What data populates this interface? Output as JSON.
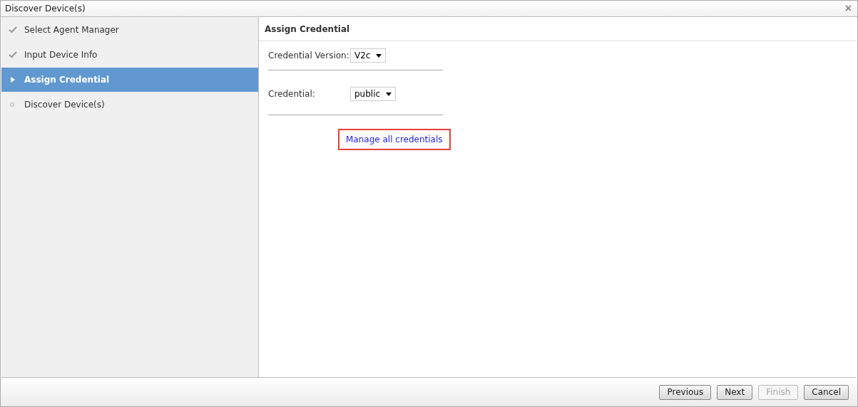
{
  "window": {
    "title": "Discover Device(s)",
    "close": "×"
  },
  "steps": [
    {
      "label": "Select Agent Manager",
      "kind": "done",
      "selected": false
    },
    {
      "label": "Input Device Info",
      "kind": "done",
      "selected": false
    },
    {
      "label": "Assign Credential",
      "kind": "current",
      "selected": true
    },
    {
      "label": "Discover Device(s)",
      "kind": "pending",
      "selected": false
    }
  ],
  "panel": {
    "title": "Assign Credential",
    "fields": [
      {
        "label": "Credential Version:",
        "value": "V2c"
      },
      {
        "label": "Credential:",
        "value": "public"
      }
    ],
    "link": {
      "label": "Manage all credentials",
      "highlighted": true
    }
  },
  "buttons": [
    {
      "label": "Previous",
      "disabled": false
    },
    {
      "label": "Next",
      "disabled": false
    },
    {
      "label": "Finish",
      "disabled": true
    },
    {
      "label": "Cancel",
      "disabled": false
    }
  ]
}
